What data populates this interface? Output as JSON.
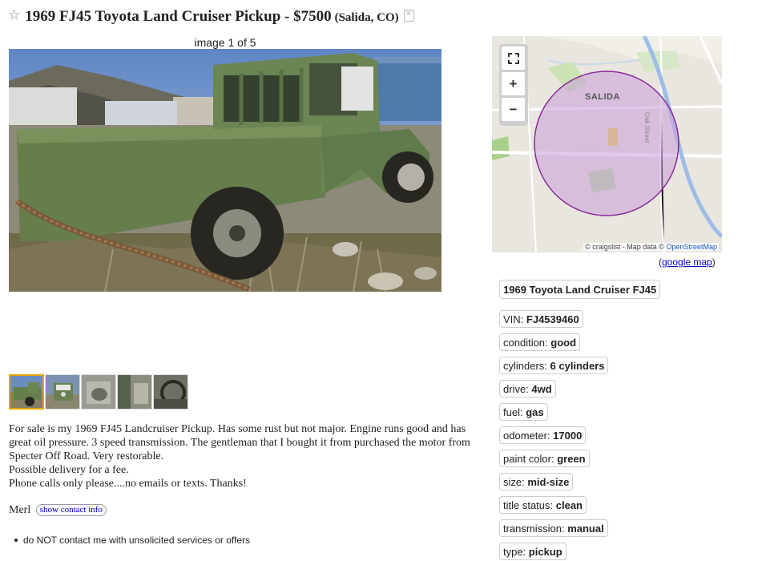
{
  "listing": {
    "title": "1969 FJ45 Toyota Land Cruiser Pickup - $7500",
    "location": "(Salida, CO)"
  },
  "gallery": {
    "counter": "image 1 of 5",
    "thumb_count": 5,
    "selected_index": 0
  },
  "description": [
    "For sale is my 1969 FJ45 Landcruiser Pickup. Has some rust but not major. Engine runs good and has great oil pressure. 3 speed transmission. The gentleman that I bought it from purchased the motor from Specter Off Road. Very restorable.",
    "Possible delivery for a fee.",
    "Phone calls only please....no emails or texts. Thanks!"
  ],
  "contact": {
    "name": "Merl",
    "button_label": "show contact info"
  },
  "notices": [
    "do NOT contact me with unsolicited services or offers"
  ],
  "map": {
    "city_label": "SALIDA",
    "street_label": "Oak Street",
    "attribution_prefix": "© craigslist - Map data ©",
    "attribution_link": "OpenStreetMap",
    "google_link_open": "(",
    "google_link_text": "google map",
    "google_link_close": ")",
    "controls": {
      "fullscreen": "fullscreen-icon",
      "zoom_in": "+",
      "zoom_out": "−"
    },
    "circle_color": "#8b2a9b"
  },
  "attributes": {
    "heading": "1969 Toyota Land Cruiser FJ45",
    "items": [
      {
        "key": "VIN: ",
        "value": "FJ4539460"
      },
      {
        "key": "condition: ",
        "value": "good"
      },
      {
        "key": "cylinders: ",
        "value": "6 cylinders"
      },
      {
        "key": "drive: ",
        "value": "4wd"
      },
      {
        "key": "fuel: ",
        "value": "gas"
      },
      {
        "key": "odometer: ",
        "value": "17000"
      },
      {
        "key": "paint color: ",
        "value": "green"
      },
      {
        "key": "size: ",
        "value": "mid-size"
      },
      {
        "key": "title status: ",
        "value": "clean"
      },
      {
        "key": "transmission: ",
        "value": "manual"
      },
      {
        "key": "type: ",
        "value": "pickup"
      }
    ]
  }
}
